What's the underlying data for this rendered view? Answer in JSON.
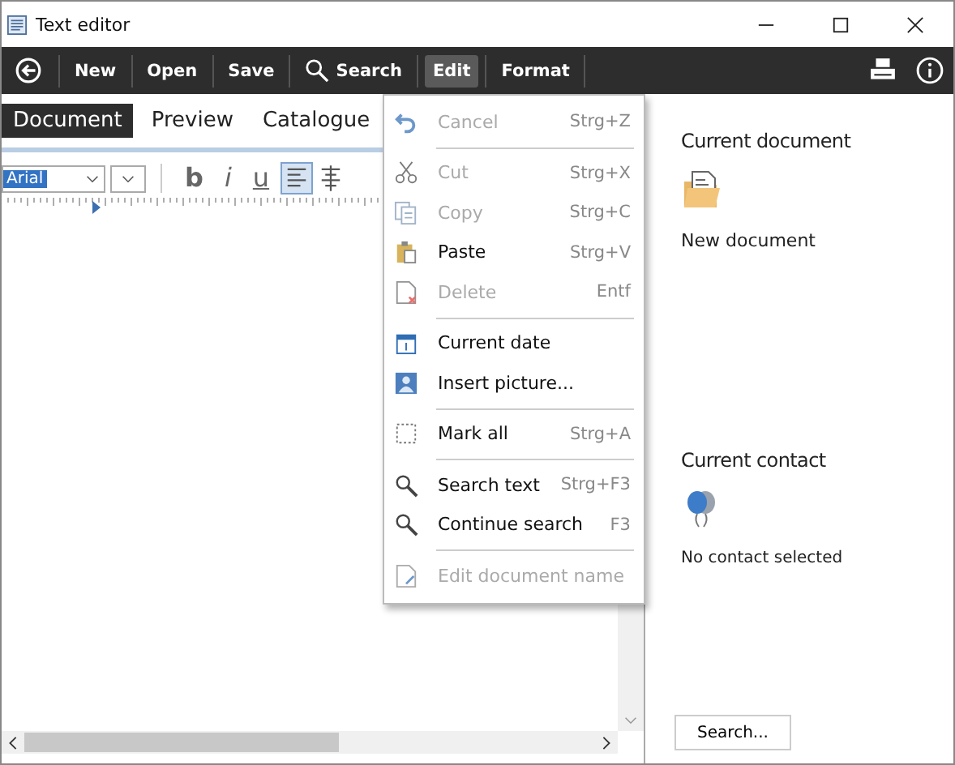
{
  "window": {
    "title": "Text editor"
  },
  "toolbar": [
    {
      "label": "New",
      "selected": false
    },
    {
      "label": "Open",
      "selected": false
    },
    {
      "label": "Save",
      "selected": false
    },
    {
      "label": "Search",
      "selected": false
    },
    {
      "label": "Edit",
      "selected": true
    },
    {
      "label": "Format",
      "selected": false
    }
  ],
  "tabs": [
    {
      "label": "Document",
      "selected": true
    },
    {
      "label": "Preview",
      "selected": false
    },
    {
      "label": "Catalogue",
      "selected": false
    }
  ],
  "format_bar": {
    "font": "Arial",
    "bold": "b",
    "italic": "i",
    "underline": "u"
  },
  "edit_menu": [
    [
      {
        "label": "Cancel",
        "shortcut": "Strg+Z",
        "disabled": true
      }
    ],
    [
      {
        "label": "Cut",
        "shortcut": "Strg+X",
        "disabled": true
      },
      {
        "label": "Copy",
        "shortcut": "Strg+C",
        "disabled": true
      },
      {
        "label": "Paste",
        "shortcut": "Strg+V",
        "disabled": false
      },
      {
        "label": "Delete",
        "shortcut": "Entf",
        "disabled": true
      }
    ],
    [
      {
        "label": "Current date",
        "disabled": false
      },
      {
        "label": "Insert picture...",
        "disabled": false
      }
    ],
    [
      {
        "label": "Mark all",
        "shortcut": "Strg+A",
        "disabled": false
      }
    ],
    [
      {
        "label": "Search text",
        "shortcut": "Strg+F3",
        "disabled": false
      },
      {
        "label": "Continue search",
        "shortcut": "F3",
        "disabled": false
      }
    ],
    [
      {
        "label": "Edit document name",
        "disabled": true
      }
    ]
  ],
  "side_panel": {
    "document_heading": "Current document",
    "document": "New document",
    "contact_heading": "Current contact",
    "contact": "No contact selected",
    "search_button": "Search..."
  }
}
